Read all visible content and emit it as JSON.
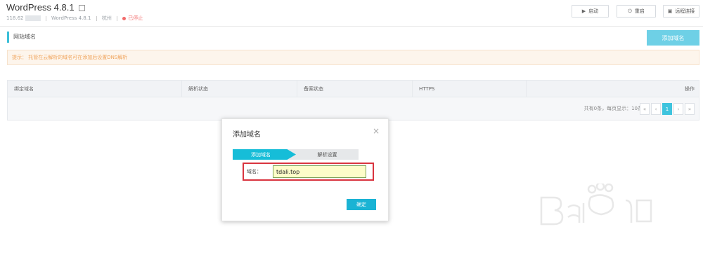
{
  "header": {
    "title": "WordPress 4.8.1",
    "ip": "118.62",
    "version": "WordPress 4.8.1",
    "zone": "杭州",
    "status": "已停止",
    "status_color": "#f26a6a",
    "buttons": [
      {
        "label": "启动",
        "icon": "play-icon"
      },
      {
        "label": "重启",
        "icon": "power-icon"
      },
      {
        "label": "远程连接",
        "icon": "remote-icon"
      }
    ]
  },
  "section": {
    "title": "网站域名",
    "add_button": "添加域名"
  },
  "tip": "提示： 托管在云解析的域名可在添加后设置DNS解析",
  "table": {
    "columns": [
      "绑定域名",
      "解析状态",
      "备案状态",
      "HTTPS",
      "操作"
    ],
    "footer_total": "共有0条，每页显示：10条",
    "pager": [
      "«",
      "‹",
      "1",
      "›",
      "»"
    ],
    "current_page": "1"
  },
  "modal": {
    "title": "添加域名",
    "close": "×",
    "steps": [
      "添加域名",
      "解析设置"
    ],
    "field_label": "域名：",
    "field_value": "tdali.top",
    "confirm": "确定"
  },
  "accent": "#16bdd8",
  "highlight_color": "#d9343f"
}
